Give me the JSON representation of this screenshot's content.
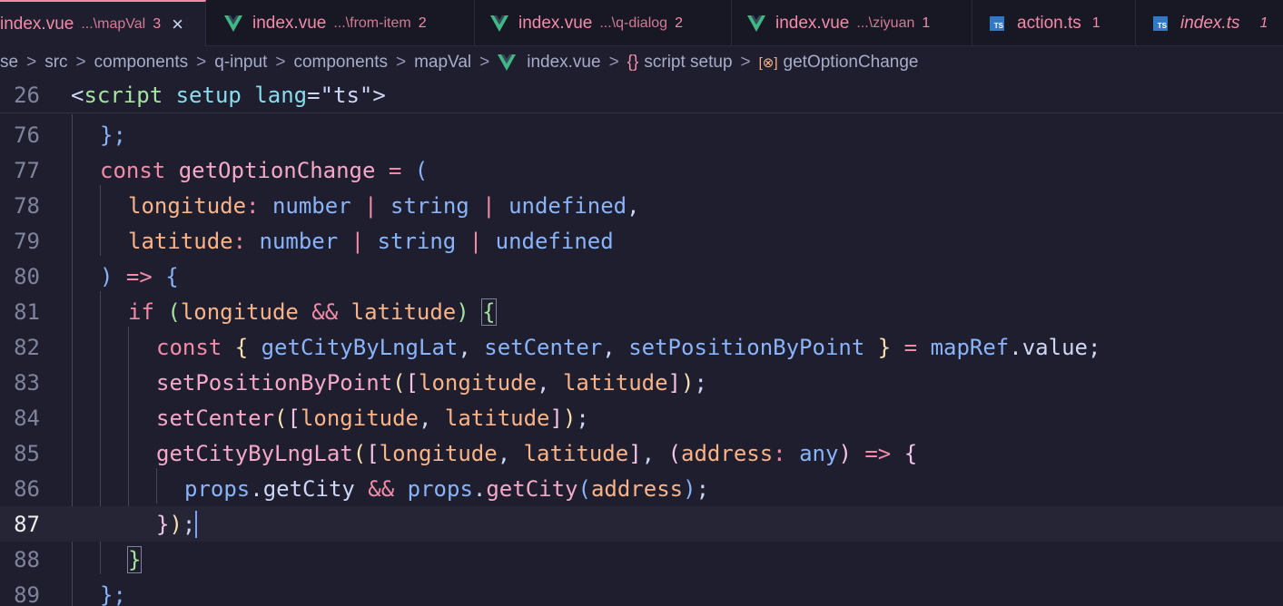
{
  "tabs": [
    {
      "name": "index.vue",
      "desc": "...\\mapVal",
      "count": "3",
      "type": "vue",
      "active": true,
      "close": "×"
    },
    {
      "name": "index.vue",
      "desc": "...\\from-item",
      "count": "2",
      "type": "vue"
    },
    {
      "name": "index.vue",
      "desc": "...\\q-dialog",
      "count": "2",
      "type": "vue"
    },
    {
      "name": "index.vue",
      "desc": "...\\ziyuan",
      "count": "1",
      "type": "vue"
    },
    {
      "name": "action.ts",
      "desc": "",
      "count": "1",
      "type": "ts"
    },
    {
      "name": "index.ts",
      "desc": "",
      "count": "1",
      "type": "ts"
    }
  ],
  "ts_logo_text": "TS",
  "breadcrumb": {
    "items": [
      "se",
      "src",
      "components",
      "q-input",
      "components",
      "mapVal",
      "index.vue",
      "{} script setup",
      "getOptionChange"
    ],
    "separator": ">",
    "braces_icon": "{}",
    "symbol_icon": "[⊗]",
    "script_label": "script setup"
  },
  "editor": {
    "current_line": "87",
    "lines": [
      {
        "n": "26"
      },
      {
        "n": "76"
      },
      {
        "n": "77"
      },
      {
        "n": "78"
      },
      {
        "n": "79"
      },
      {
        "n": "80"
      },
      {
        "n": "81"
      },
      {
        "n": "82"
      },
      {
        "n": "83"
      },
      {
        "n": "84"
      },
      {
        "n": "85"
      },
      {
        "n": "86"
      },
      {
        "n": "87"
      },
      {
        "n": "88"
      },
      {
        "n": "89"
      }
    ],
    "tokens": {
      "l26": [
        "<",
        "script",
        " setup",
        " lang",
        "=",
        "\"ts\"",
        ">"
      ],
      "l76": [
        "};"
      ],
      "l77": [
        "const",
        " getOptionChange",
        " = ",
        "("
      ],
      "l78": [
        "longitude",
        ": ",
        "number",
        " | ",
        "string",
        " | ",
        "undefined",
        ","
      ],
      "l79": [
        "latitude",
        ": ",
        "number",
        " | ",
        "string",
        " | ",
        "undefined"
      ],
      "l80": [
        ")",
        " => ",
        "{"
      ],
      "l81": [
        "if",
        " (",
        "longitude",
        " && ",
        "latitude",
        ")",
        " ",
        "{"
      ],
      "l82": [
        "const",
        " {",
        " getCityByLngLat",
        ",",
        " setCenter",
        ",",
        " setPositionByPoint",
        " }",
        " = ",
        "mapRef",
        ".value;"
      ],
      "l83": [
        "setPositionByPoint",
        "(",
        "[",
        "longitude",
        ", ",
        "latitude",
        "]",
        ")",
        ";"
      ],
      "l84": [
        "setCenter",
        "(",
        "[",
        "longitude",
        ", ",
        "latitude",
        "]",
        ")",
        ";"
      ],
      "l85": [
        "getCityByLngLat",
        "(",
        "[",
        "longitude",
        ", ",
        "latitude",
        "]",
        ", ",
        "(",
        "address",
        ": ",
        "any",
        ")",
        " => ",
        "{"
      ],
      "l86": [
        "props",
        ".getCity",
        " && ",
        "props",
        ".",
        "getCity",
        "(",
        "address",
        ")",
        ";"
      ],
      "l87": [
        "}",
        ")",
        ";"
      ],
      "l88": [
        "}"
      ],
      "l89": [
        "};"
      ]
    }
  },
  "colors": {
    "background": "#1e1e2e",
    "tab_error": "#f38ba8",
    "vue_green": "#41b883",
    "ts_blue": "#3178c6",
    "cursor": "#7aa2f7"
  },
  "icons": {
    "vue": "vue-logo-icon",
    "ts": "typescript-icon",
    "close": "close-icon",
    "braces": "braces-icon",
    "symbol": "symbol-variable-icon"
  }
}
